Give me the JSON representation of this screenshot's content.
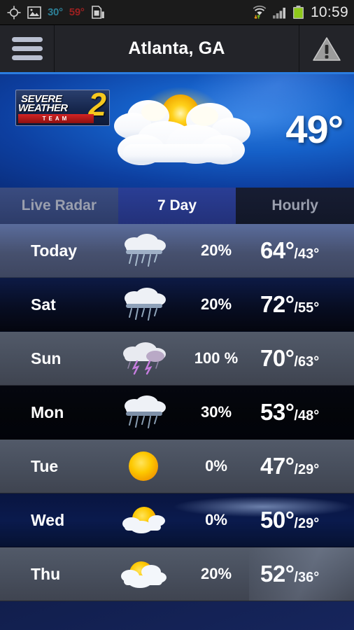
{
  "statusbar": {
    "gps_icon": "gps-crosshair-icon",
    "gallery_icon": "image-gallery-icon",
    "temp_teal": "30°",
    "temp_red": "59°",
    "sim_icon": "sim-card-icon",
    "wifi_icon": "wifi-transfer-icon",
    "signal_icon": "cellular-signal-icon",
    "battery_icon": "battery-full-icon",
    "time": "10:59"
  },
  "header": {
    "menu_icon": "hamburger-menu-icon",
    "title": "Atlanta, GA",
    "alert_icon": "warning-triangle-icon"
  },
  "hero": {
    "logo": {
      "line1": "SEVERE",
      "line2": "WEATHER",
      "big": "2",
      "team": "TEAM"
    },
    "condition_icon": "sun-behind-clouds-icon",
    "current_temp": "49°"
  },
  "tabs": [
    {
      "label": "Live Radar",
      "active": false
    },
    {
      "label": "7 Day",
      "active": true
    },
    {
      "label": "Hourly",
      "active": false
    }
  ],
  "forecast": {
    "rows": [
      {
        "day": "Today",
        "icon": "rain-shower-icon",
        "pop": "20%",
        "high": "64°",
        "low": "/43°"
      },
      {
        "day": "Sat",
        "icon": "rain-shower-icon",
        "pop": "20%",
        "high": "72°",
        "low": "/55°"
      },
      {
        "day": "Sun",
        "icon": "thunderstorm-icon",
        "pop": "100 %",
        "high": "70°",
        "low": "/63°"
      },
      {
        "day": "Mon",
        "icon": "rain-shower-icon",
        "pop": "30%",
        "high": "53°",
        "low": "/48°"
      },
      {
        "day": "Tue",
        "icon": "sunny-icon",
        "pop": "0%",
        "high": "47°",
        "low": "/29°"
      },
      {
        "day": "Wed",
        "icon": "partly-cloudy-icon",
        "pop": "0%",
        "high": "50°",
        "low": "/29°"
      },
      {
        "day": "Thu",
        "icon": "partly-cloudy-icon",
        "pop": "20%",
        "high": "52°",
        "low": "/36°"
      }
    ]
  },
  "colors": {
    "accent_blue": "#2b7de0",
    "sun_yellow": "#f7c81e",
    "alert_red": "#9b2020",
    "status_teal": "#2d7f96"
  }
}
